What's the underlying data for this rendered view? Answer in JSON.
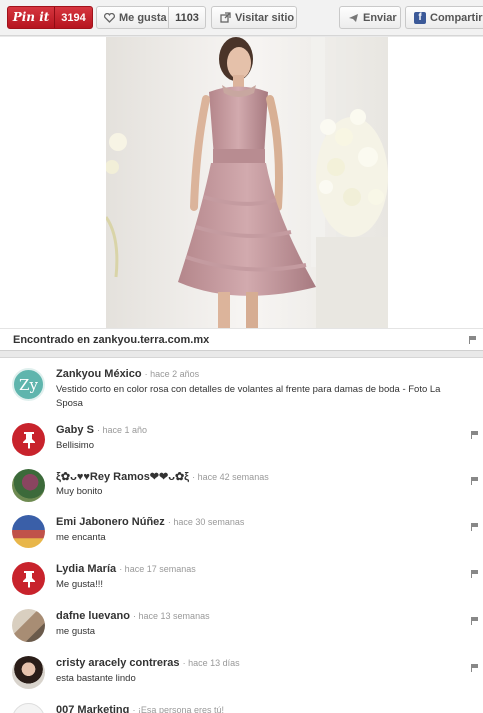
{
  "toolbar": {
    "pin_label": "Pin it",
    "pin_count": "3194",
    "like_label": "Me gusta",
    "like_count": "1103",
    "visit_label": "Visitar sitio",
    "send_label": "Enviar",
    "share_label": "Compartir"
  },
  "source": {
    "found_label": "Encontrado en zankyou.terra.com.mx"
  },
  "comments": [
    {
      "name": "Zankyou México",
      "time": "· hace 2 años",
      "text": "Vestido corto en color rosa con detalles de volantes al frente para damas de boda - Foto La Sposa"
    },
    {
      "name": "Gaby S",
      "time": "· hace 1 año",
      "text": "Bellisimo"
    },
    {
      "name": "ξ✿ᴗ♥♥Rey Ramos❤❤ᴗ✿ξ",
      "time": "· hace 42 semanas",
      "text": "Muy bonito"
    },
    {
      "name": "Emi Jabonero Núñez",
      "time": "· hace 30 semanas",
      "text": "me encanta"
    },
    {
      "name": "Lydia María",
      "time": "· hace 17 semanas",
      "text": "Me gusta!!!"
    },
    {
      "name": "dafne luevano",
      "time": "· hace 13 semanas",
      "text": "me gusta"
    },
    {
      "name": "cristy aracely contreras",
      "time": "· hace 13 días",
      "text": "esta bastante lindo"
    },
    {
      "name": "007 Marketing",
      "time": "· ¡Esa persona eres tú!",
      "text": ""
    }
  ],
  "colors": {
    "pinterest_red": "#c8232c",
    "zankyou_teal": "#5fb5ad",
    "facebook_blue": "#3b5998"
  }
}
